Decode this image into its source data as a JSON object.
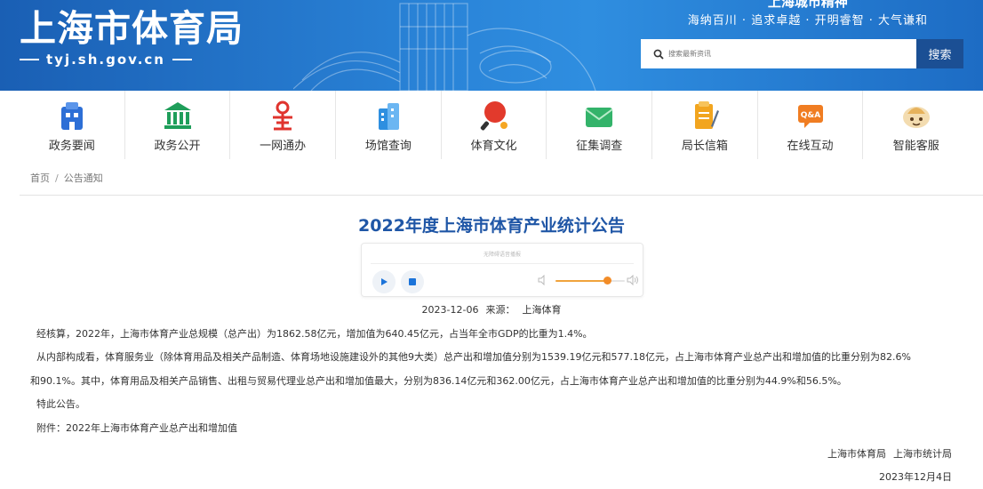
{
  "header": {
    "logo_text": "上海市体育局",
    "logo_url": "tyj.sh.gov.cn",
    "spirit_title": "上海城市精神",
    "spirit_text": "海纳百川 · 追求卓越 · 开明睿智 · 大气谦和",
    "search_placeholder": "搜索最新资讯",
    "search_button": "搜索"
  },
  "nav": [
    {
      "label": "政务要闻",
      "icon": "news-building-icon",
      "color": "#2d6fd6"
    },
    {
      "label": "政务公开",
      "icon": "government-building-icon",
      "color": "#1f9e5a"
    },
    {
      "label": "一网通办",
      "icon": "service-icon",
      "color": "#e0342e"
    },
    {
      "label": "场馆查询",
      "icon": "venue-icon",
      "color": "#2e8fe0"
    },
    {
      "label": "体育文化",
      "icon": "table-tennis-icon",
      "color": "#e23a2c"
    },
    {
      "label": "征集调查",
      "icon": "survey-envelope-icon",
      "color": "#33b36a"
    },
    {
      "label": "局长信箱",
      "icon": "mailbox-notepad-icon",
      "color": "#f2a51f"
    },
    {
      "label": "在线互动",
      "icon": "qa-chat-icon",
      "color": "#f07d22"
    },
    {
      "label": "智能客服",
      "icon": "robot-assistant-icon",
      "color": "#e6b25c"
    }
  ],
  "breadcrumb": {
    "home": "首页",
    "sep": "/",
    "current": "公告通知"
  },
  "article": {
    "title": "2022年度上海市体育产业统计公告",
    "player_label": "无障碍语音播报",
    "volume": 0.75,
    "date": "2023-12-06",
    "source_label": "来源：",
    "source": "上海体育",
    "p1": "经核算，2022年，上海市体育产业总规模（总产出）为1862.58亿元，增加值为640.45亿元，占当年全市GDP的比重为1.4%。",
    "p2a": "从内部构成看，体育服务业（除体育用品及相关产品制造、体育场地设施建设外的其他9大类）总产出和增加值分别为1539.19亿元和577.18亿元，占上海市体育产业总产出和增加值的比重分别为82.6%",
    "p2b": "和90.1%。其中，体育用品及相关产品销售、出租与贸易代理业总产出和增加值最大，分别为836.14亿元和362.00亿元，占上海市体育产业总产出和增加值的比重分别为44.9%和56.5%。",
    "p3": "特此公告。",
    "p4": "附件：2022年上海市体育产业总产出和增加值",
    "signer1": "上海市体育局",
    "signer2": "上海市统计局",
    "sign_date": "2023年12月4日"
  }
}
